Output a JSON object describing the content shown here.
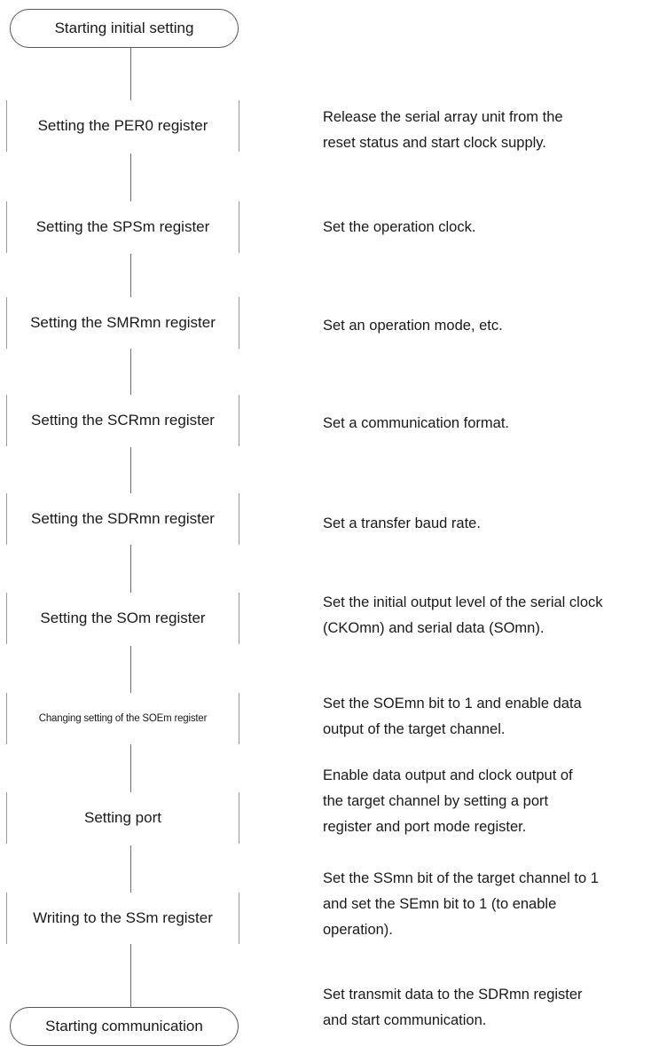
{
  "flow": {
    "start": "Starting initial setting",
    "steps": [
      "Setting the PER0 register",
      "Setting the SPSm register",
      "Setting the SMRmn register",
      "Setting the SCRmn register",
      "Setting the SDRmn register",
      "Setting the SOm register",
      "Changing setting of the SOEm register",
      "Setting port",
      "Writing to the SSm register"
    ],
    "end": "Starting communication"
  },
  "notes": [
    [
      "Release the serial array unit from the",
      "reset status and start clock supply."
    ],
    [
      "Set the operation clock."
    ],
    [
      "Set an operation mode, etc."
    ],
    [
      "Set a communication format."
    ],
    [
      "Set a transfer baud rate."
    ],
    [
      "Set the initial output level of the serial clock",
      "(CKOmn) and serial data (SOmn)."
    ],
    [
      "Set the SOEmn bit to 1 and enable data",
      "output of the target channel."
    ],
    [
      "Enable data output and clock output of",
      "the target channel by setting a port",
      "register and port mode register."
    ],
    [
      "Set the SSmn bit of the target channel to 1",
      "and set the SEmn bit to 1 (to enable",
      "operation)."
    ],
    [
      "Set transmit data to the SDRmn register",
      "and start communication."
    ]
  ]
}
